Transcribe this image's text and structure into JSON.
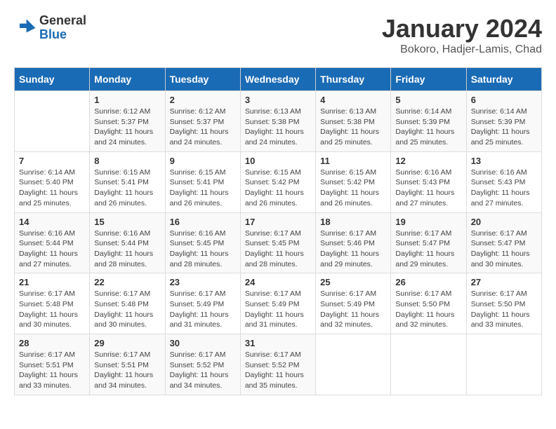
{
  "header": {
    "logo_general": "General",
    "logo_blue": "Blue",
    "title": "January 2024",
    "subtitle": "Bokoro, Hadjer-Lamis, Chad"
  },
  "calendar": {
    "days_of_week": [
      "Sunday",
      "Monday",
      "Tuesday",
      "Wednesday",
      "Thursday",
      "Friday",
      "Saturday"
    ],
    "weeks": [
      [
        {
          "day": "",
          "info": ""
        },
        {
          "day": "1",
          "info": "Sunrise: 6:12 AM\nSunset: 5:37 PM\nDaylight: 11 hours\nand 24 minutes."
        },
        {
          "day": "2",
          "info": "Sunrise: 6:12 AM\nSunset: 5:37 PM\nDaylight: 11 hours\nand 24 minutes."
        },
        {
          "day": "3",
          "info": "Sunrise: 6:13 AM\nSunset: 5:38 PM\nDaylight: 11 hours\nand 24 minutes."
        },
        {
          "day": "4",
          "info": "Sunrise: 6:13 AM\nSunset: 5:38 PM\nDaylight: 11 hours\nand 25 minutes."
        },
        {
          "day": "5",
          "info": "Sunrise: 6:14 AM\nSunset: 5:39 PM\nDaylight: 11 hours\nand 25 minutes."
        },
        {
          "day": "6",
          "info": "Sunrise: 6:14 AM\nSunset: 5:39 PM\nDaylight: 11 hours\nand 25 minutes."
        }
      ],
      [
        {
          "day": "7",
          "info": "Sunrise: 6:14 AM\nSunset: 5:40 PM\nDaylight: 11 hours\nand 25 minutes."
        },
        {
          "day": "8",
          "info": "Sunrise: 6:15 AM\nSunset: 5:41 PM\nDaylight: 11 hours\nand 26 minutes."
        },
        {
          "day": "9",
          "info": "Sunrise: 6:15 AM\nSunset: 5:41 PM\nDaylight: 11 hours\nand 26 minutes."
        },
        {
          "day": "10",
          "info": "Sunrise: 6:15 AM\nSunset: 5:42 PM\nDaylight: 11 hours\nand 26 minutes."
        },
        {
          "day": "11",
          "info": "Sunrise: 6:15 AM\nSunset: 5:42 PM\nDaylight: 11 hours\nand 26 minutes."
        },
        {
          "day": "12",
          "info": "Sunrise: 6:16 AM\nSunset: 5:43 PM\nDaylight: 11 hours\nand 27 minutes."
        },
        {
          "day": "13",
          "info": "Sunrise: 6:16 AM\nSunset: 5:43 PM\nDaylight: 11 hours\nand 27 minutes."
        }
      ],
      [
        {
          "day": "14",
          "info": "Sunrise: 6:16 AM\nSunset: 5:44 PM\nDaylight: 11 hours\nand 27 minutes."
        },
        {
          "day": "15",
          "info": "Sunrise: 6:16 AM\nSunset: 5:44 PM\nDaylight: 11 hours\nand 28 minutes."
        },
        {
          "day": "16",
          "info": "Sunrise: 6:16 AM\nSunset: 5:45 PM\nDaylight: 11 hours\nand 28 minutes."
        },
        {
          "day": "17",
          "info": "Sunrise: 6:17 AM\nSunset: 5:45 PM\nDaylight: 11 hours\nand 28 minutes."
        },
        {
          "day": "18",
          "info": "Sunrise: 6:17 AM\nSunset: 5:46 PM\nDaylight: 11 hours\nand 29 minutes."
        },
        {
          "day": "19",
          "info": "Sunrise: 6:17 AM\nSunset: 5:47 PM\nDaylight: 11 hours\nand 29 minutes."
        },
        {
          "day": "20",
          "info": "Sunrise: 6:17 AM\nSunset: 5:47 PM\nDaylight: 11 hours\nand 30 minutes."
        }
      ],
      [
        {
          "day": "21",
          "info": "Sunrise: 6:17 AM\nSunset: 5:48 PM\nDaylight: 11 hours\nand 30 minutes."
        },
        {
          "day": "22",
          "info": "Sunrise: 6:17 AM\nSunset: 5:48 PM\nDaylight: 11 hours\nand 30 minutes."
        },
        {
          "day": "23",
          "info": "Sunrise: 6:17 AM\nSunset: 5:49 PM\nDaylight: 11 hours\nand 31 minutes."
        },
        {
          "day": "24",
          "info": "Sunrise: 6:17 AM\nSunset: 5:49 PM\nDaylight: 11 hours\nand 31 minutes."
        },
        {
          "day": "25",
          "info": "Sunrise: 6:17 AM\nSunset: 5:49 PM\nDaylight: 11 hours\nand 32 minutes."
        },
        {
          "day": "26",
          "info": "Sunrise: 6:17 AM\nSunset: 5:50 PM\nDaylight: 11 hours\nand 32 minutes."
        },
        {
          "day": "27",
          "info": "Sunrise: 6:17 AM\nSunset: 5:50 PM\nDaylight: 11 hours\nand 33 minutes."
        }
      ],
      [
        {
          "day": "28",
          "info": "Sunrise: 6:17 AM\nSunset: 5:51 PM\nDaylight: 11 hours\nand 33 minutes."
        },
        {
          "day": "29",
          "info": "Sunrise: 6:17 AM\nSunset: 5:51 PM\nDaylight: 11 hours\nand 34 minutes."
        },
        {
          "day": "30",
          "info": "Sunrise: 6:17 AM\nSunset: 5:52 PM\nDaylight: 11 hours\nand 34 minutes."
        },
        {
          "day": "31",
          "info": "Sunrise: 6:17 AM\nSunset: 5:52 PM\nDaylight: 11 hours\nand 35 minutes."
        },
        {
          "day": "",
          "info": ""
        },
        {
          "day": "",
          "info": ""
        },
        {
          "day": "",
          "info": ""
        }
      ]
    ]
  }
}
